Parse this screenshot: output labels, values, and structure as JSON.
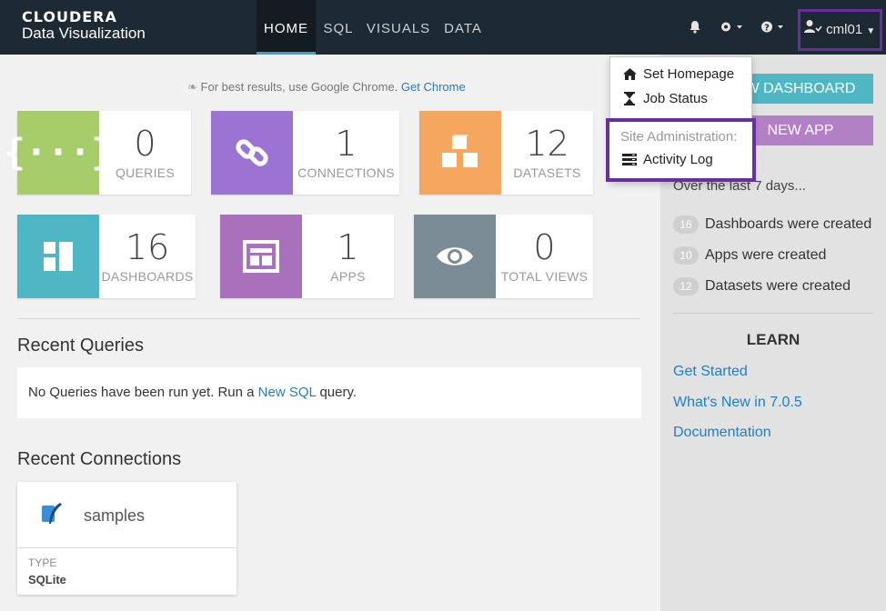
{
  "brand": {
    "line1": "CLOUDERA",
    "line2": "Data Visualization"
  },
  "nav": {
    "tabs": [
      {
        "label": "HOME"
      },
      {
        "label": "SQL"
      },
      {
        "label": "VISUALS"
      },
      {
        "label": "DATA"
      }
    ]
  },
  "user": {
    "name": "cml01"
  },
  "banner": {
    "text": "For best results, use Google Chrome.",
    "link": "Get Chrome"
  },
  "tiles": [
    {
      "value": "0",
      "label": "QUERIES",
      "color": "#a7cd6b",
      "icon": "braces-icon"
    },
    {
      "value": "1",
      "label": "CONNECTIONS",
      "color": "#9b74d3",
      "icon": "link-icon"
    },
    {
      "value": "12",
      "label": "DATASETS",
      "color": "#f5a760",
      "icon": "cubes-icon"
    },
    {
      "value": "16",
      "label": "DASHBOARDS",
      "color": "#4fb6c4",
      "icon": "dashboard-icon"
    },
    {
      "value": "1",
      "label": "APPS",
      "color": "#a970bc",
      "icon": "app-icon"
    },
    {
      "value": "0",
      "label": "TOTAL VIEWS",
      "color": "#7a8b94",
      "icon": "eye-icon"
    }
  ],
  "recent_queries": {
    "title": "Recent Queries",
    "empty_prefix": "No Queries have been run yet. Run a",
    "link": "New SQL",
    "suffix": "query."
  },
  "recent_connections": {
    "title": "Recent Connections",
    "items": [
      {
        "name": "samples",
        "type_label": "TYPE",
        "type": "SQLite"
      }
    ]
  },
  "sidebar": {
    "new_dashboard": "W DASHBOARD",
    "new_app": "NEW APP",
    "period": "Over the last 7 days...",
    "stats": [
      {
        "count": "16",
        "text": "Dashboards were created"
      },
      {
        "count": "10",
        "text": "Apps were created"
      },
      {
        "count": "12",
        "text": "Datasets were created"
      }
    ],
    "learn_title": "LEARN",
    "links": [
      "Get Started",
      "What's New in 7.0.5",
      "Documentation"
    ]
  },
  "dropdown": {
    "items": [
      {
        "label": "Set Homepage",
        "icon": "home-icon"
      },
      {
        "label": "Job Status",
        "icon": "hourglass-icon"
      }
    ],
    "section": "Site Administration:",
    "admin_item": {
      "label": "Activity Log",
      "icon": "server-icon"
    }
  },
  "colors": {
    "highlight": "#6a2ea0",
    "link": "#1f7fc0",
    "topbar": "#1e2a33",
    "dashboard_btn": "#4fb6c4",
    "app_btn": "#b280c5"
  }
}
